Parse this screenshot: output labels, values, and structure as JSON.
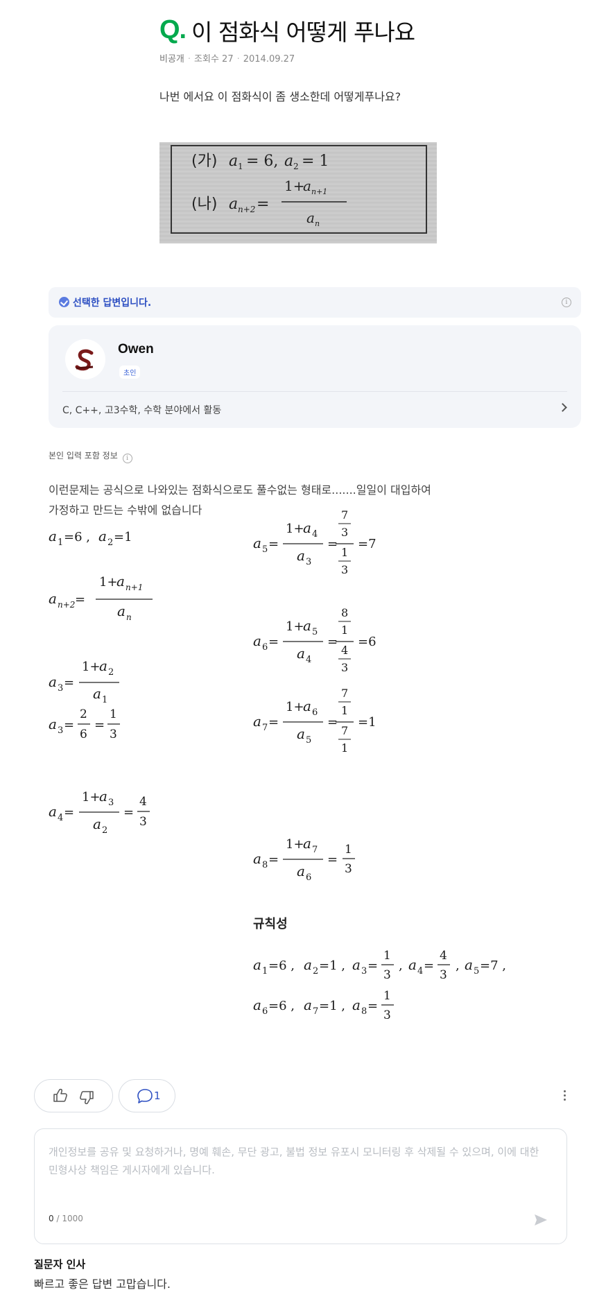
{
  "question": {
    "q_mark": "Q.",
    "title": "이 점화식 어떻게 푸나요",
    "privacy": "비공개",
    "views": "조회수 27",
    "date": "2014.09.27",
    "body": "나번 에서요 이 점화식이 좀 생소한데 어떻게푸나요?",
    "image_formula": {
      "line1_label": "(가)",
      "line1": "a₁ = 6, a₂ = 1",
      "line2_label": "(나)",
      "line2": "aₙ₊₂ = (1 + aₙ₊₁) / aₙ"
    }
  },
  "selected": {
    "label": "선택한 답변입니다.",
    "info_icon": "info-icon"
  },
  "profile": {
    "name": "Owen",
    "grade": "초인",
    "activity": "C, C++, 고3수학, 수학 분야에서 활동"
  },
  "self_info": "본인 입력 포함 정보",
  "answer": {
    "line1": "이런문제는 공식으로 나와있는 점화식으로도 풀수없는 형태로.......일일이 대입하여",
    "line2": "가정하고 만드는 수밖에 없습니다",
    "pattern_heading": "규칙성",
    "pattern_values": [
      "a1=6",
      "a2=1",
      "a3=1/3",
      "a4=4/3",
      "a5=7",
      "a6=6",
      "a7=1",
      "a8=1/3"
    ]
  },
  "actions": {
    "like_icon": "thumbs-up-icon",
    "dislike_icon": "thumbs-down-icon",
    "comment_icon": "speech-bubble-icon",
    "comment_count": "1",
    "more_icon": "more-vertical-icon"
  },
  "reply": {
    "placeholder": "개인정보를 공유 및 요청하거나, 명예 훼손, 무단 광고, 불법 정보 유포시 모니터링 후 삭제될 수 있으며, 이에 대한 민형사상 책임은 게시자에게 있습니다.",
    "count_current": "0",
    "count_max": " / 1000",
    "send_icon": "send-icon"
  },
  "greeting": {
    "title": "질문자 인사",
    "text": "빠르고 좋은 답변 고맙습니다."
  },
  "colors": {
    "brand_green": "#03a94d",
    "accent_blue": "#2d4fc2",
    "panel_bg": "#f3f5f9"
  }
}
